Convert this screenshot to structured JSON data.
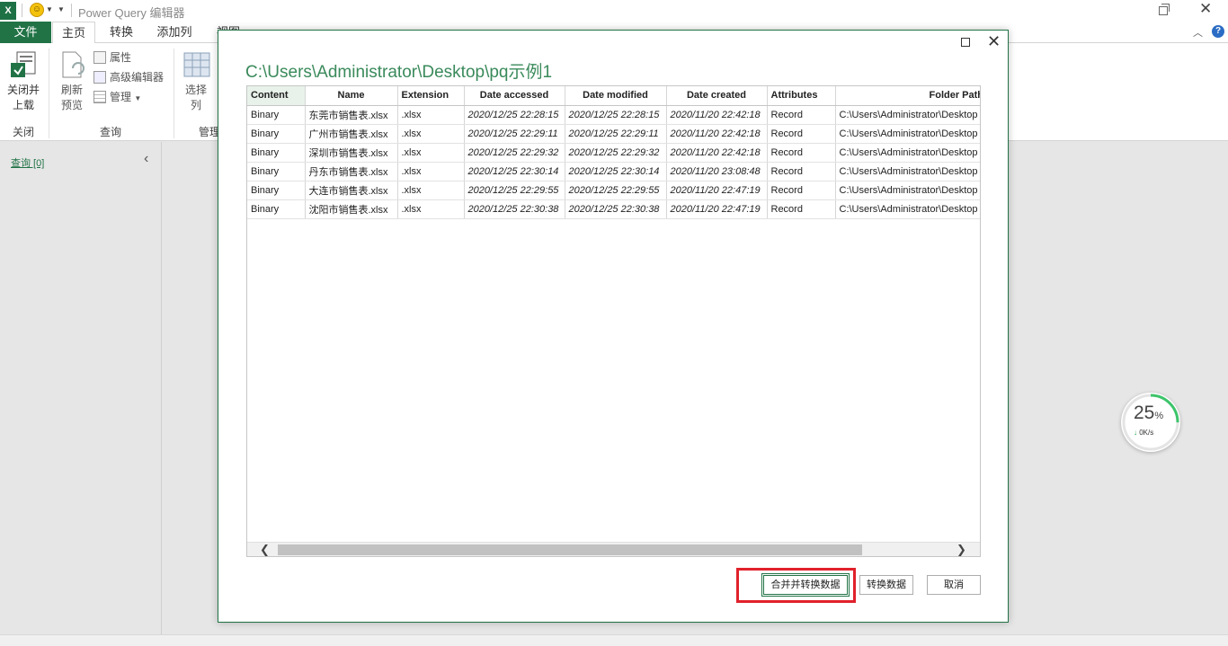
{
  "app": {
    "title": "Power Query 编辑器",
    "logo": "X"
  },
  "ribbon_tabs": [
    "文件",
    "主页",
    "转换",
    "添加列",
    "视图"
  ],
  "ribbon": {
    "close_load": "关闭并\n上载",
    "close_group": "关闭",
    "refresh": "刷新\n预览",
    "properties": "属性",
    "advanced_editor": "高级编辑器",
    "manage": "管理",
    "query_group": "查询",
    "choose_cols": "选择\n列",
    "manage_group": "管理"
  },
  "left_pane": {
    "queries_label": "查询 [0]"
  },
  "dialog": {
    "title": "C:\\Users\\Administrator\\Desktop\\pq示例1",
    "columns": [
      "Content",
      "Name",
      "Extension",
      "Date accessed",
      "Date modified",
      "Date created",
      "Attributes",
      "Folder Path"
    ],
    "rows": [
      [
        "Binary",
        "东莞市销售表.xlsx",
        ".xlsx",
        "2020/12/25 22:28:15",
        "2020/12/25 22:28:15",
        "2020/11/20 22:42:18",
        "Record",
        "C:\\Users\\Administrator\\Desktop"
      ],
      [
        "Binary",
        "广州市销售表.xlsx",
        ".xlsx",
        "2020/12/25 22:29:11",
        "2020/12/25 22:29:11",
        "2020/11/20 22:42:18",
        "Record",
        "C:\\Users\\Administrator\\Desktop"
      ],
      [
        "Binary",
        "深圳市销售表.xlsx",
        ".xlsx",
        "2020/12/25 22:29:32",
        "2020/12/25 22:29:32",
        "2020/11/20 22:42:18",
        "Record",
        "C:\\Users\\Administrator\\Desktop"
      ],
      [
        "Binary",
        "丹东市销售表.xlsx",
        ".xlsx",
        "2020/12/25 22:30:14",
        "2020/12/25 22:30:14",
        "2020/11/20 23:08:48",
        "Record",
        "C:\\Users\\Administrator\\Desktop"
      ],
      [
        "Binary",
        "大连市销售表.xlsx",
        ".xlsx",
        "2020/12/25 22:29:55",
        "2020/12/25 22:29:55",
        "2020/11/20 22:47:19",
        "Record",
        "C:\\Users\\Administrator\\Desktop"
      ],
      [
        "Binary",
        "沈阳市销售表.xlsx",
        ".xlsx",
        "2020/12/25 22:30:38",
        "2020/12/25 22:30:38",
        "2020/11/20 22:47:19",
        "Record",
        "C:\\Users\\Administrator\\Desktop"
      ]
    ],
    "buttons": {
      "combine_transform": "合并并转换数据",
      "transform": "转换数据",
      "cancel": "取消"
    }
  },
  "net_monitor": {
    "percent": "25",
    "percent_unit": "%",
    "speed": "0K/s",
    "progress_fraction": 0.25
  },
  "colors": {
    "accent": "#217346",
    "highlight": "#e0212b"
  }
}
